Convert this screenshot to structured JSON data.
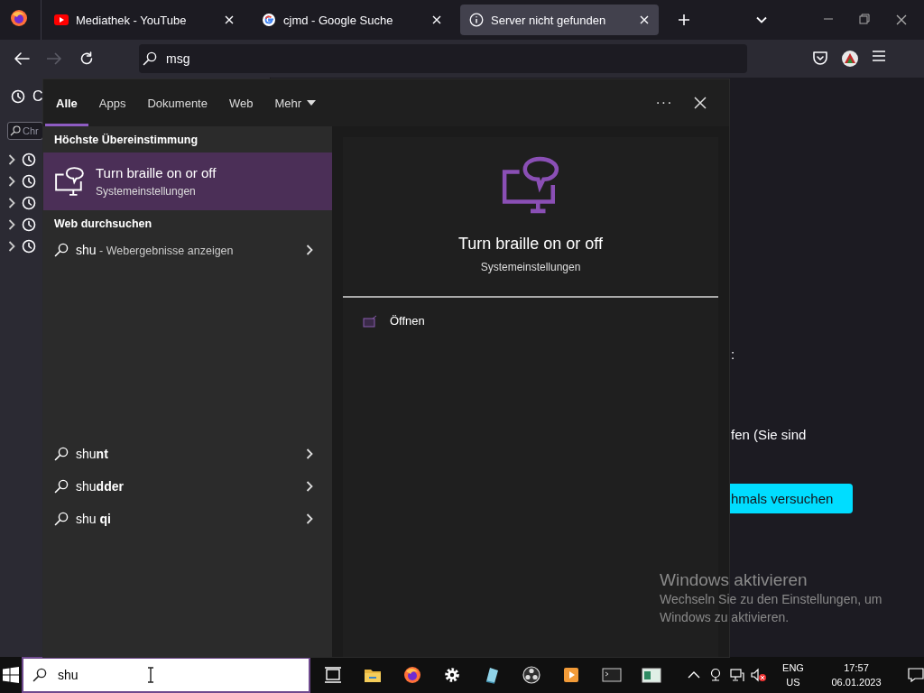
{
  "browser": {
    "tabs": [
      {
        "title": "Mediathek - YouTube",
        "kind": "video",
        "selected": false
      },
      {
        "title": "cjmd - Google Suche",
        "kind": "search",
        "selected": false
      },
      {
        "title": "Server nicht gefunden",
        "kind": "error",
        "selected": true
      }
    ],
    "address": "msg",
    "sidebar": {
      "title": "C",
      "search_placeholder": "Chr",
      "rows": [
        {
          "expanded": false
        },
        {
          "expanded": false
        },
        {
          "expanded": false
        },
        {
          "expanded": false
        },
        {
          "expanded": false
        }
      ]
    },
    "page": {
      "text_1": ":",
      "text_2": "fen (Sie sind",
      "button": "hmals versuchen"
    }
  },
  "search_panel": {
    "tabs": [
      {
        "label": "Alle",
        "kind": "tab",
        "selected": true
      },
      {
        "label": "Apps",
        "kind": "tab",
        "selected": false
      },
      {
        "label": "Dokumente",
        "kind": "tab",
        "selected": false
      },
      {
        "label": "Web",
        "kind": "tab",
        "selected": false
      },
      {
        "label": "Mehr",
        "kind": "dropdown",
        "selected": false
      }
    ],
    "more_button": "···",
    "best_match": {
      "heading": "Höchste Übereinstimmung",
      "title": "Turn braille on or off",
      "subtitle": "Systemeinstellungen",
      "selected": true
    },
    "web": {
      "heading": "Web durchsuchen",
      "query": "shu",
      "hint": " - Webergebnisse anzeigen"
    },
    "suggestions": [
      "shu**nt**",
      "shu**dder**",
      "shu **qi**"
    ],
    "preview": {
      "title": "Turn braille on or off",
      "subtitle": "Systemeinstellungen",
      "actions": [
        "Öffnen"
      ]
    }
  },
  "activation": {
    "title": "Windows aktivieren",
    "lines": [
      "Wechseln Sie zu den Einstellungen, um",
      "Windows zu aktivieren."
    ]
  },
  "taskbar": {
    "search_value": "shu",
    "apps": [
      {
        "kind": "task-view"
      },
      {
        "kind": "folder"
      },
      {
        "kind": "firefox"
      },
      {
        "kind": "settings"
      },
      {
        "kind": "notepad"
      },
      {
        "kind": "obs"
      },
      {
        "kind": "media"
      },
      {
        "kind": "terminal"
      },
      {
        "kind": "window"
      }
    ],
    "language": "ENG",
    "layout": "US",
    "time": "17:57",
    "date": "06.01.2023"
  }
}
